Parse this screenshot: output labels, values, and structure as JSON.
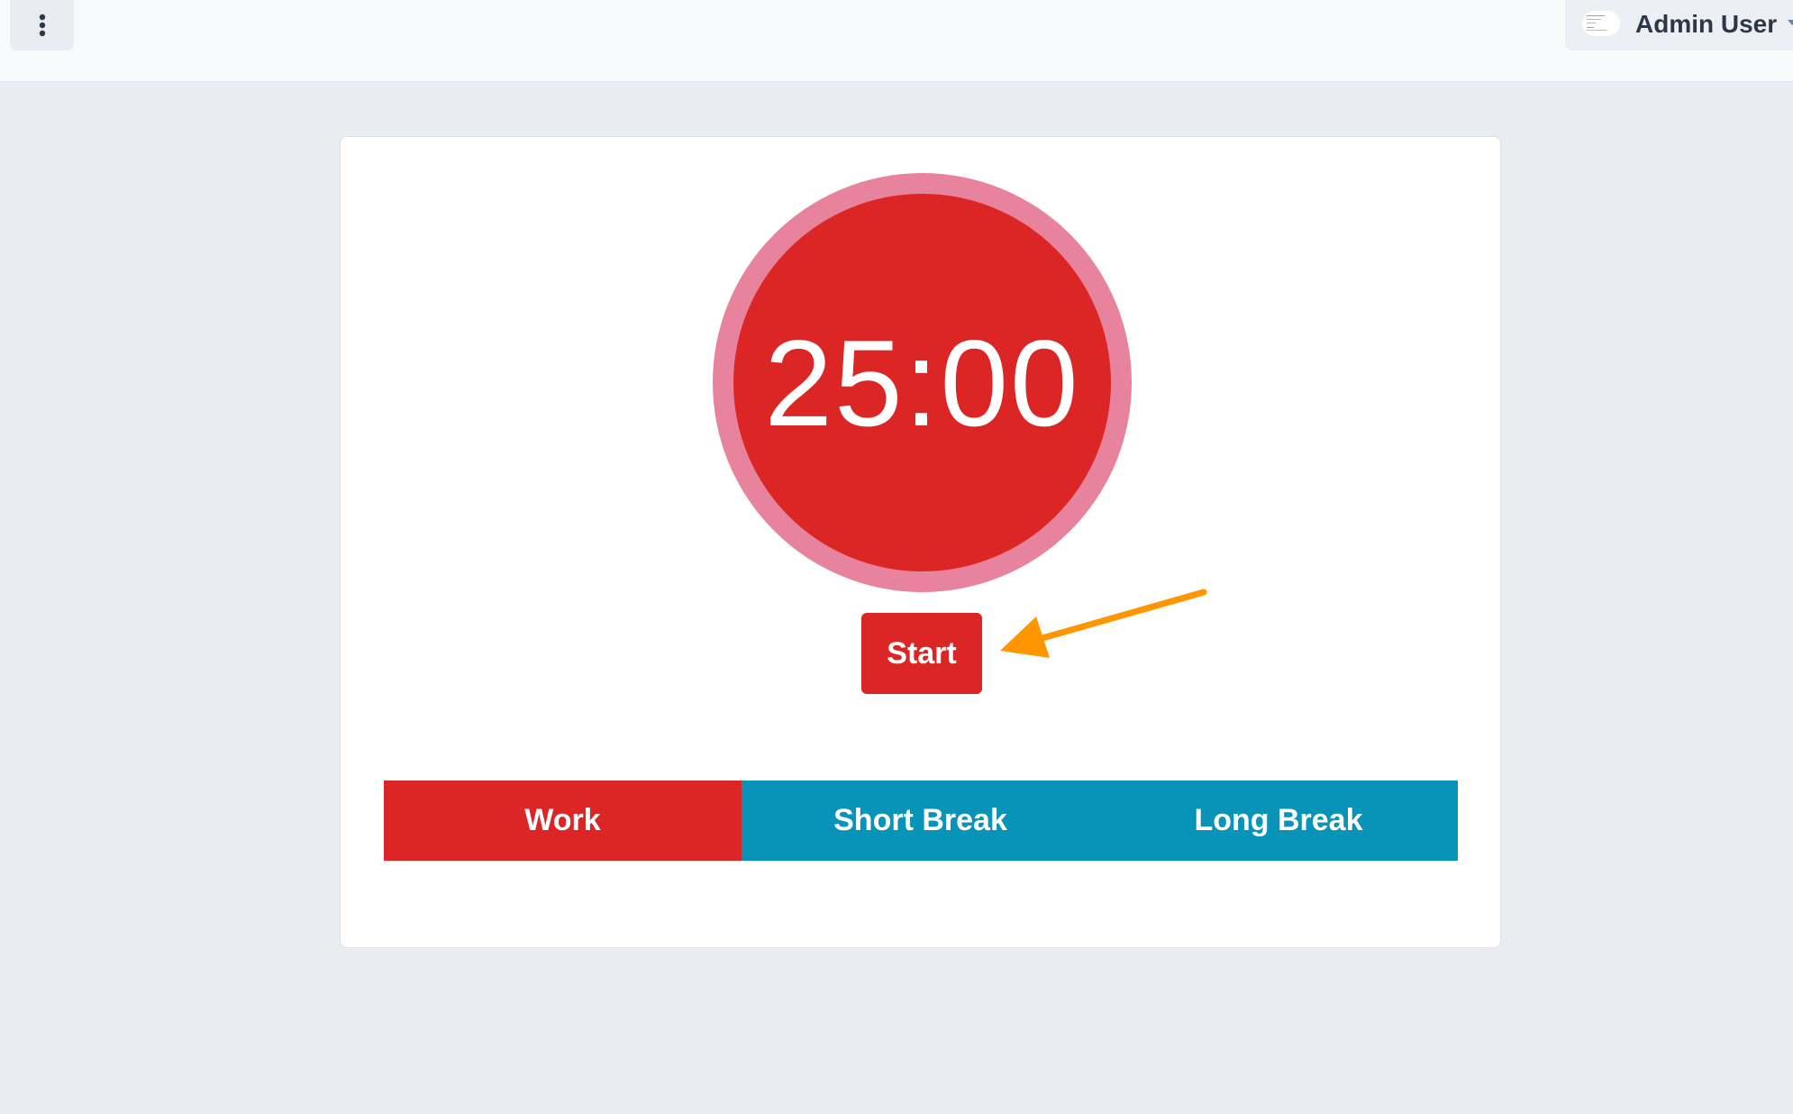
{
  "topbar": {
    "menu_icon": "kebab-menu-icon",
    "user": {
      "name": "Admin User",
      "avatar_icon": "avatar-icon",
      "caret_icon": "chevron-down-icon"
    }
  },
  "timer": {
    "display": "25:00",
    "start_label": "Start",
    "colors": {
      "ring": "#e8839d",
      "core": "#dc2626",
      "button": "#dc2626"
    }
  },
  "annotation": {
    "arrow_icon": "arrow-left-icon",
    "color": "#ff9500"
  },
  "modes": {
    "active": "Work",
    "items": [
      {
        "label": "Work",
        "color": "#dc2626"
      },
      {
        "label": "Short Break",
        "color": "#0893b8"
      },
      {
        "label": "Long Break",
        "color": "#0893b8"
      }
    ]
  }
}
